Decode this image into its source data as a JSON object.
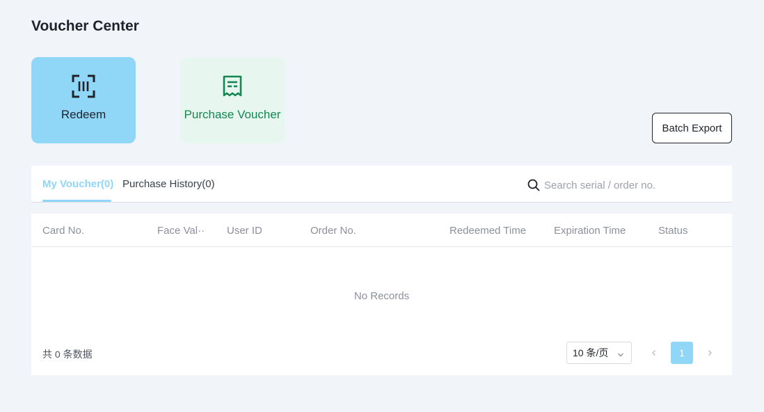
{
  "page": {
    "title": "Voucher Center"
  },
  "actions": {
    "redeem_label": "Redeem",
    "purchase_label": "Purchase Voucher",
    "batch_export_label": "Batch Export"
  },
  "tabs": [
    {
      "label": "My Voucher(0)",
      "active": true
    },
    {
      "label": "Purchase History(0)",
      "active": false
    }
  ],
  "search": {
    "placeholder": "Search serial / order no.",
    "value": ""
  },
  "table": {
    "columns": [
      "Card No.",
      "Face Val···",
      "User ID",
      "Order No.",
      "Redeemed Time",
      "Expiration Time",
      "Status"
    ],
    "rows": [],
    "empty_text": "No Records"
  },
  "pagination": {
    "total_text": "共 0 条数据",
    "page_size": "10 条/页",
    "current_page": "1"
  },
  "colors": {
    "accent": "#8fd6f7",
    "purchase_bg": "#e7f7ef",
    "purchase_text": "#13874f",
    "background": "#f1f4f9"
  },
  "icons": {
    "redeem": "scan-barcode-icon",
    "purchase": "receipt-icon",
    "search": "search-icon",
    "page_size": "chevron-down-icon",
    "prev": "chevron-left-icon",
    "next": "chevron-right-icon"
  }
}
